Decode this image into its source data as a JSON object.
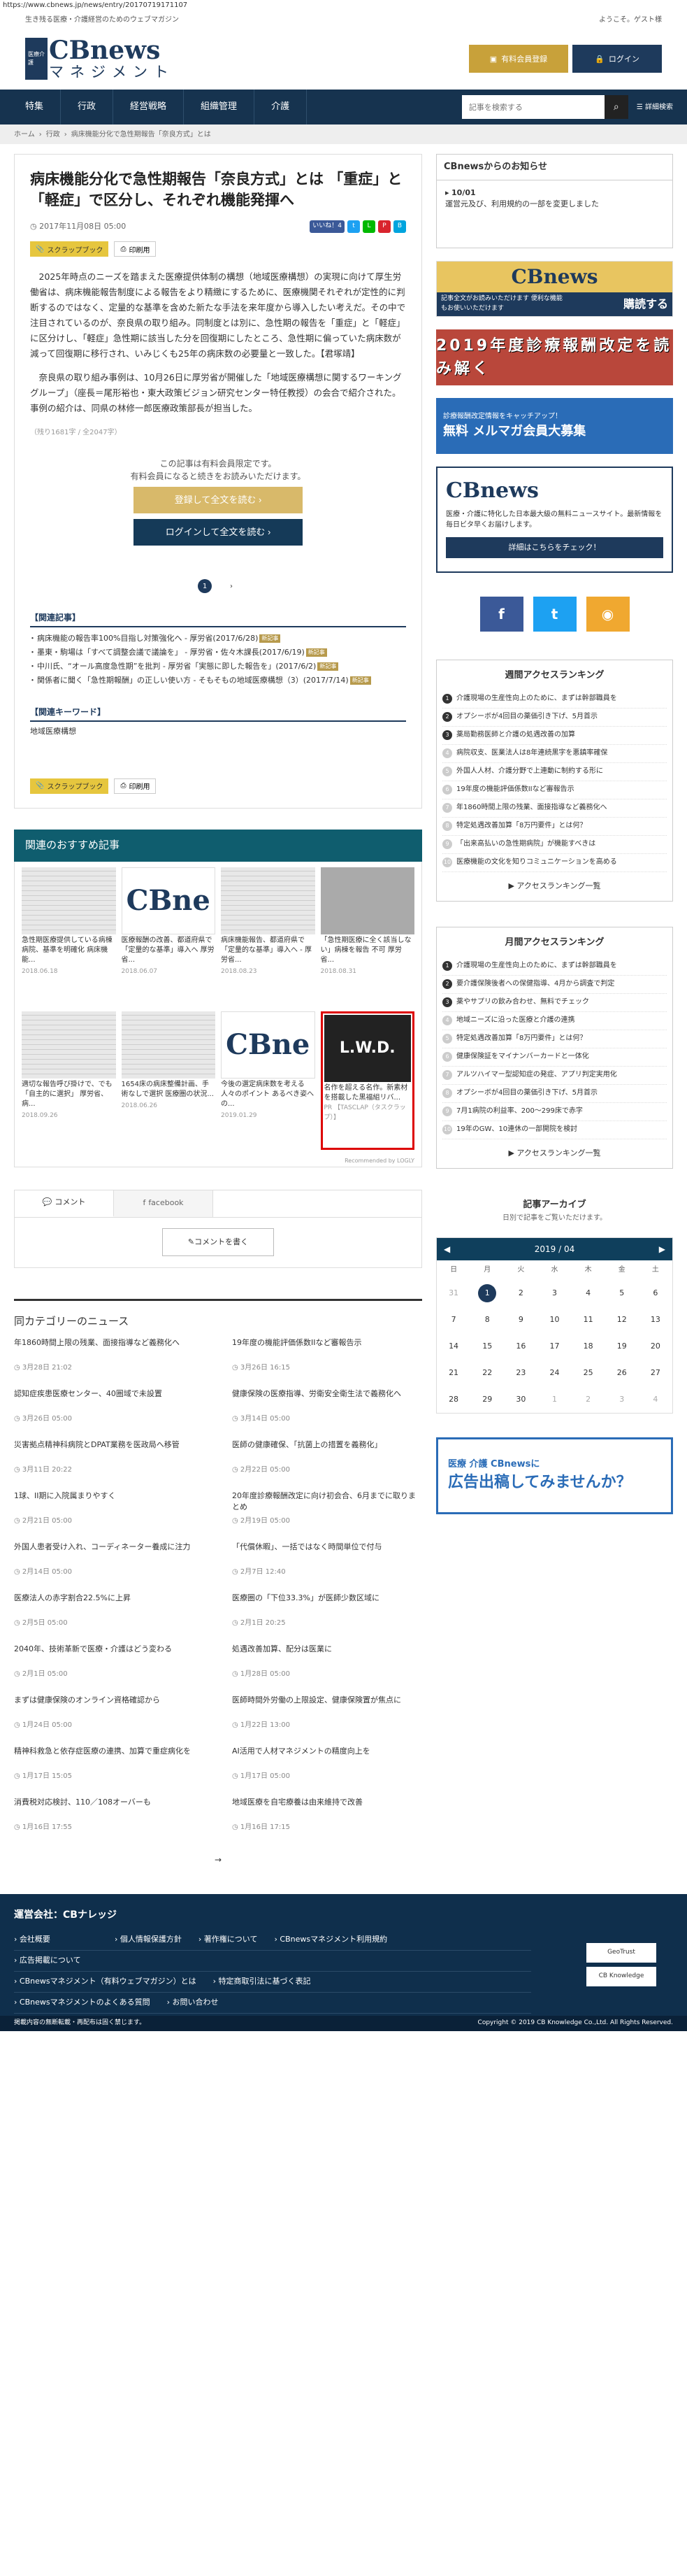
{
  "url": "https://www.cbnews.jp/news/entry/20170719171107",
  "topline": {
    "left": "生き残る医療・介護経営のためのウェブマガジン",
    "right": "ようこそ。ゲスト様"
  },
  "logo": {
    "box": "医療介護",
    "main": "CBnews",
    "sub": "マネジメント"
  },
  "header": {
    "register": "有料会員登録",
    "login": "ログイン"
  },
  "nav": {
    "items": [
      "特集",
      "行政",
      "経営戦略",
      "組織管理",
      "介護"
    ],
    "search_placeholder": "記事を検索する",
    "detail": "詳細検索"
  },
  "breadcrumb": [
    "ホーム",
    "行政",
    "病床機能分化で急性期報告「奈良方式」とは"
  ],
  "article": {
    "title": "病床機能分化で急性期報告「奈良方式」とは 「重症」と「軽症」で区分し、それぞれ機能発揮へ",
    "date": "2017年11月08日 05:00",
    "like": "いいね！4",
    "scrap": "スクラップブック",
    "print": "印刷用",
    "p1": "2025年時点のニーズを踏まえた医療提供体制の構想（地域医療構想）の実現に向けて厚生労働省は、病床機能報告制度による報告をより精緻にするために、医療機関それぞれが定性的に判断するのではなく、定量的な基準を含めた新たな手法を来年度から導入したい考えだ。その中で注目されているのが、奈良県の取り組み。同制度とは別に、急性期の報告を「重症」と「軽症」に区分けし、「軽症」急性期に該当した分を回復期にしたところ、急性期に偏っていた病床数が減って回復期に移行され、いみじくも25年の病床数の必要量と一致した。【君塚靖】",
    "p2": "奈良県の取り組み事例は、10月26日に厚労省が開催した「地域医療構想に関するワーキンググループ」（座長＝尾形裕也・東大政策ビジョン研究センター特任教授）の会合で紹介された。事例の紹介は、同県の林修一郎医療政策部長が担当した。",
    "count": "（残り1681字 / 全2047字）",
    "member_note1": "この記事は有料会員限定です。",
    "member_note2": "有料会員になると続きをお読みいただけます。",
    "btn_register": "登録して全文を読む",
    "btn_login": "ログインして全文を読む",
    "page": "1",
    "related_h": "【関連記事】",
    "related": [
      {
        "t": "病床機能の報告率100%目指し対策強化へ - 厚労省(2017/6/28)",
        "nb": "新記事"
      },
      {
        "t": "墨東・駒場は「すべて調整会議で議論を」 - 厚労省・佐々木課長(2017/6/19)",
        "nb": "新記事"
      },
      {
        "t": "中川氏、“オール高度急性期”を批判 - 厚労省「実態に即した報告を」(2017/6/2)",
        "nb": "新記事"
      },
      {
        "t": "関係者に聞く「急性期報酬」の正しい使い方 - そもそもの地域医療構想（3）(2017/7/14)",
        "nb": "新記事"
      }
    ],
    "kw_h": "【関連キーワード】",
    "kw": "地域医療構想"
  },
  "reco": {
    "heading": "関連のおすすめ記事",
    "items": [
      {
        "t": "急性期医療提供している病棟病院、基準を明確化 病床機能...",
        "d": "2018.06.18"
      },
      {
        "t": "医療報酬の改善、都道府県で「定量的な基準」導入へ 厚労省...",
        "d": "2018.06.07"
      },
      {
        "t": "病床機能報告、都道府県で「定量的な基準」導入へ - 厚労省...",
        "d": "2018.08.23"
      },
      {
        "t": "「急性期医療に全く該当しない」病棟を報告 不可 厚労省...",
        "d": "2018.08.31"
      },
      {
        "t": "適切な報告呼び掛けで、でも「自主的に選択」 厚労省、病...",
        "d": "2018.09.26"
      },
      {
        "t": "1654床の病床整備計画、手術なしで選択 医療圏の状況...",
        "d": "2018.06.26"
      },
      {
        "t": "今後の選定病床数を考える人々のポイント あるべき姿への...",
        "d": "2019.01.29"
      }
    ],
    "ad": {
      "img": "L.W.D.",
      "t": "名作を超える名作。新素材を搭載した黒福組リバ...",
      "tag": "PR 【TASCLAP（タスクラップ）】"
    },
    "by": "Recommended by LOGLY"
  },
  "comments": {
    "tab1": "コメント",
    "tab2": "facebook",
    "write": "コメントを書く"
  },
  "category": {
    "heading": "同カテゴリーのニュース",
    "items": [
      {
        "t": "年1860時間上限の残業、面接指導など義務化へ",
        "d": "3月28日 21:02"
      },
      {
        "t": "19年度の機能評価係数IIなど審報告示",
        "d": "3月26日 16:15"
      },
      {
        "t": "認知症疾患医療センター、40圏域で未設置",
        "d": "3月26日 05:00"
      },
      {
        "t": "健康保険の医療指導、労衛安全衛生法で義務化へ",
        "d": "3月14日 05:00"
      },
      {
        "t": "災害拠点精神科病院とDPAT業務を医政局へ移管",
        "d": "3月11日 20:22"
      },
      {
        "t": "医師の健康確保、「抗菌上の措置を義務化」",
        "d": "2月22日 05:00"
      },
      {
        "t": "1球、II期に入院属まりやすく",
        "d": "2月21日 05:00"
      },
      {
        "t": "20年度診療報酬改定に向け初会合、6月までに取りまとめ",
        "d": "2月19日 05:00"
      },
      {
        "t": "外国人患者受け入れ、コーディネーター養成に注力",
        "d": "2月14日 05:00"
      },
      {
        "t": "「代償休暇」、一括ではなく時間単位で付与",
        "d": "2月7日 12:40"
      },
      {
        "t": "医療法人の赤字割合22.5%に上昇",
        "d": "2月5日 05:00"
      },
      {
        "t": "医療圏の「下位33.3%」が医師少数区域に",
        "d": "2月1日 20:25"
      },
      {
        "t": "2040年、技術革新で医療・介護はどう変わる",
        "d": "2月1日 05:00"
      },
      {
        "t": "処遇改善加算、配分は医業に",
        "d": "1月28日 05:00"
      },
      {
        "t": "まずは健康保険のオンライン資格確認から",
        "d": "1月24日 05:00"
      },
      {
        "t": "医師時間外労働の上限設定、健康保険置が焦点に",
        "d": "1月22日 13:00"
      },
      {
        "t": "精神科救急と依存症医療の連携、加算で重症病化を",
        "d": "1月17日 15:05"
      },
      {
        "t": "AI活用で人材マネジメントの精度向上を",
        "d": "1月17日 05:00"
      },
      {
        "t": "消費税対応検討、110／108オーバーも",
        "d": "1月16日 17:55"
      },
      {
        "t": "地域医療を自宅療養は由来維持で改善",
        "d": "1月16日 17:15"
      }
    ],
    "next": "→"
  },
  "side": {
    "notice_h": "CBnewsからのお知らせ",
    "notice_date": "10/01",
    "notice_text": "運営元及び、利用規約の一部を変更しました",
    "bn1_main": "CBnews",
    "bn1_sub": "マネジメント",
    "bn1_note": "記事全文がお読みいただけます 便利な機能もお使いいただけます",
    "bn1_cta": "購読する",
    "bn2": "2019年度診療報酬改定を読み解く",
    "bn3_s": "診療報酬改定情報をキャッチアップ！",
    "bn3_b": "無料 メルマガ会員大募集",
    "bn4_logo": "CBnews",
    "bn4_text": "医療・介護に特化した日本最大級の無料ニュースサイト。最新情報を毎日ビタ早くお届けします。",
    "bn4_btn": "詳細はこちらをチェック！",
    "weekly_h": "週間アクセスランキング",
    "weekly": [
      "介護現場の生産性向上のために、まずは幹部職員を",
      "オプシーボが4回目の薬価引き下げ、5月首示",
      "薬局勤務医師と介護の処遇改善の加算",
      "病院収支、医業法人は8年連続黒字を悪鎮率確保",
      "外国人人材、介護分野で上連動に制約する形に",
      "19年度の機能評価係数IIなど審報告示",
      "年1860時間上限の残業、面接指導など義務化へ",
      "特定処遇改善加算「8万円要件」とは何？",
      "「出来高払いの急性期病院」が機能すべきは",
      "医療機能の文化を知りコミュニケーションを高める"
    ],
    "more": "アクセスランキング一覧",
    "monthly_h": "月間アクセスランキング",
    "monthly": [
      "介護現場の生産性向上のために、まずは幹部職員を",
      "要介護保険後者への保健指導、4月から調査で判定",
      "薬やサプリの飲み合わせ、無料でチェック",
      "地域ニーズに沿った医療と介護の連携",
      "特定処遇改善加算「8万円要件」とは何？",
      "健康保険証をマイナンバーカードと一体化",
      "アルツハイマー型認知症の発症、アプリ判定実用化",
      "オプシーボが4回目の薬価引き下げ、5月首示",
      "7月1病院の利益率、200～299床で赤字",
      "19年のGW、10連休の一部開院を検討"
    ],
    "archive_h": "記事アーカイブ",
    "archive_sub": "日別で記事をご覧いただけます。",
    "cal_title": "2019 / 04",
    "cal_days": [
      "日",
      "月",
      "火",
      "水",
      "木",
      "金",
      "土"
    ],
    "cal_cells": [
      "31",
      "1",
      "2",
      "3",
      "4",
      "5",
      "6",
      "7",
      "8",
      "9",
      "10",
      "11",
      "12",
      "13",
      "14",
      "15",
      "16",
      "17",
      "18",
      "19",
      "20",
      "21",
      "22",
      "23",
      "24",
      "25",
      "26",
      "27",
      "28",
      "29",
      "30",
      "1",
      "2",
      "3",
      "4"
    ],
    "bn5_a": "医療 介護 CBnewsに",
    "bn5_b": "広告出稿してみませんか？"
  },
  "footer": {
    "title": "運営会社：CBナレッジ",
    "rows": [
      [
        "会社概要",
        "個人情報保護方針",
        "著作権について",
        "CBnewsマネジメント利用規約"
      ],
      [
        "広告掲載について"
      ],
      [
        "CBnewsマネジメント（有料ウェブマガジン）とは",
        "特定商取引法に基づく表記"
      ],
      [
        "CBnewsマネジメントのよくある質問",
        "お問い合わせ"
      ]
    ],
    "badge1": "GeoTrust",
    "badge2": "CB Knowledge",
    "bottom_left": "掲載内容の無断転載・再配布は固く禁じます。",
    "bottom_right": "Copyright © 2019 CB Knowledge Co.,Ltd. All Rights Reserved."
  }
}
